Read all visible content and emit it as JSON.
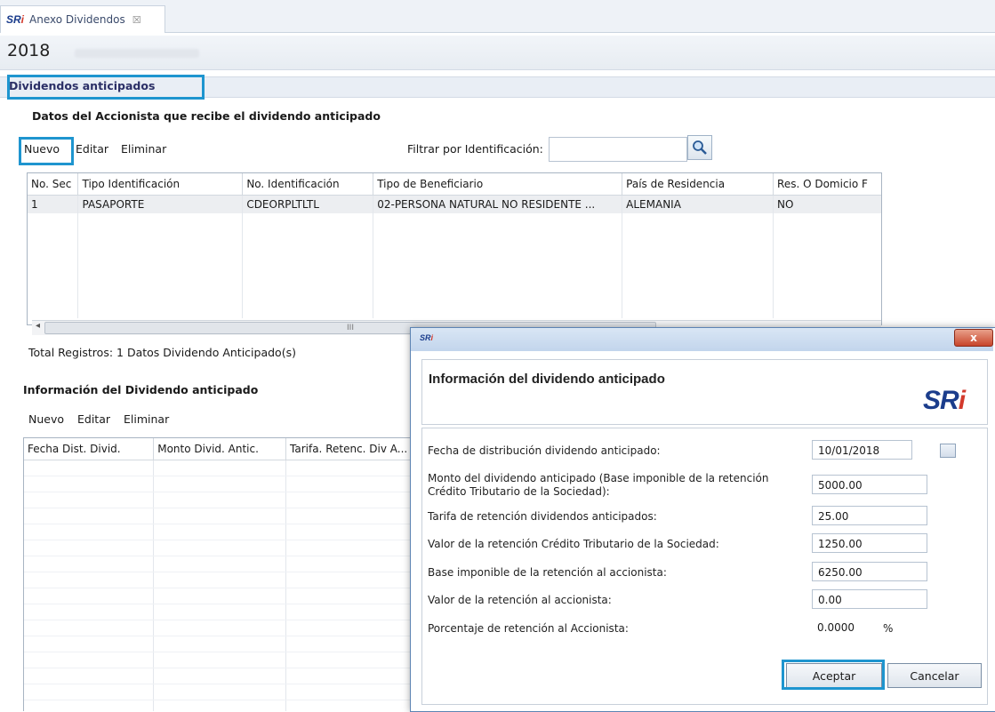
{
  "tab": {
    "app_logo": "SRi",
    "title": "Anexo Dividendos",
    "close_glyph": "☒"
  },
  "header": {
    "year": "2018"
  },
  "section": {
    "title": "Dividendos anticipados"
  },
  "shareholders": {
    "title": "Datos del Accionista que recibe el dividendo anticipado",
    "actions": {
      "new": "Nuevo",
      "edit": "Editar",
      "delete": "Eliminar"
    },
    "filter_label": "Filtrar por Identificación:",
    "filter_value": "",
    "columns": [
      "No. Sec",
      "Tipo Identificación",
      "No. Identificación",
      "Tipo de Beneficiario",
      "País de Residencia",
      "Res. O Domicio F"
    ],
    "rows": [
      [
        "1",
        "PASAPORTE",
        "CDEORPLTLTL",
        "02-PERSONA NATURAL NO RESIDENTE ...",
        "ALEMANIA",
        "NO"
      ]
    ],
    "scroll_glyph": "III",
    "total": "Total Registros: 1 Datos Dividendo Anticipado(s)"
  },
  "dividend_info": {
    "title": "Información del Dividendo anticipado",
    "actions": {
      "new": "Nuevo",
      "edit": "Editar",
      "delete": "Eliminar"
    },
    "columns": [
      "Fecha Dist. Divid.",
      "Monto Divid. Antic.",
      "Tarifa. Retenc. Div A..."
    ]
  },
  "dialog": {
    "logo": "SRi",
    "close": "x",
    "title": "Información del dividendo anticipado",
    "fields": [
      {
        "label": "Fecha de distribución dividendo anticipado:",
        "value": "10/01/2018"
      },
      {
        "label": "Monto del dividendo anticipado (Base imponible de la retención",
        "label2": "Crédito Tributario de la Sociedad):",
        "value": "5000.00"
      },
      {
        "label": "Tarifa de retención dividendos anticipados:",
        "value": "25.00"
      },
      {
        "label": "Valor de la retención Crédito Tributario de la Sociedad:",
        "value": "1250.00"
      },
      {
        "label": "Base imponible de la retención al accionista:",
        "value": "6250.00"
      },
      {
        "label": "Valor de la retención al accionista:",
        "value": "0.00"
      },
      {
        "label": "Porcentaje de retención al Accionista:",
        "value": "0.0000",
        "unit": "%"
      }
    ],
    "ok": "Aceptar",
    "cancel": "Cancelar"
  },
  "colors": {
    "highlight": "#1e95cf",
    "brand_blue": "#1b3d8c",
    "brand_red": "#d33a2c"
  }
}
